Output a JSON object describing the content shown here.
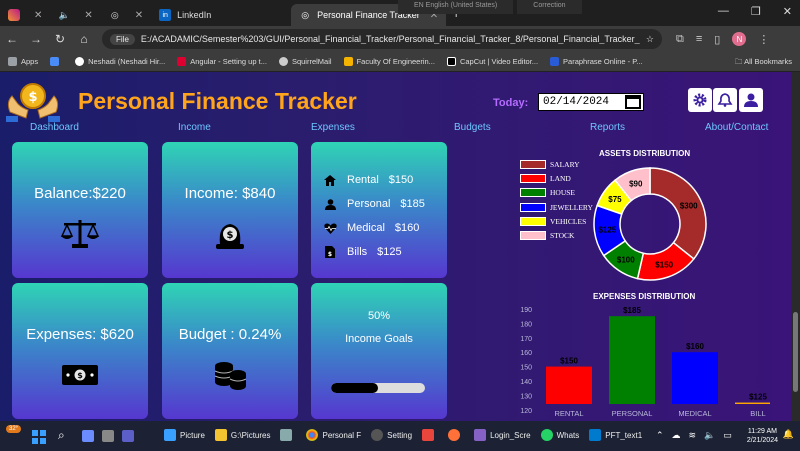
{
  "browser": {
    "tabs": [
      {
        "label": "",
        "icon": "instagram-icon"
      },
      {
        "label": "",
        "icon": "audio-icon"
      },
      {
        "label": "",
        "icon": "globe-icon"
      },
      {
        "label": "LinkedIn",
        "icon": "linkedin-icon"
      },
      {
        "label": "Personal Finance Tracker",
        "icon": "globe-icon",
        "active": true
      }
    ],
    "overlay_left": "EN English (United States)",
    "overlay_right": "Correction",
    "file_chip": "File",
    "url": "E:/ACADAMIC/Semester%203/GUI/Personal_Financial_Tracker/Personal_Financial_Tracker_8/Personal_Financial_Tracker_6/PFT_text1....",
    "profile_initial": "N",
    "bookmarks": [
      {
        "label": "Apps",
        "color": "#9aa0a6"
      },
      {
        "label": "",
        "color": "#4a8cf7"
      },
      {
        "label": "Neshadi (Neshadi Hir...",
        "color": "#ffffff"
      },
      {
        "label": "Angular - Setting up t...",
        "color": "#dd0031"
      },
      {
        "label": "SquirrelMail",
        "color": "#cccccc"
      },
      {
        "label": "Faculty Of Engineerin...",
        "color": "#f4b400"
      },
      {
        "label": "CapCut | Video Editor...",
        "color": "#000000"
      },
      {
        "label": "Paraphrase Online - P...",
        "color": "#2a5bd7"
      }
    ],
    "all_bookmarks": "All Bookmarks"
  },
  "app": {
    "title": "Personal Finance Tracker",
    "today_label": "Today:",
    "date_value": "02/14/2024",
    "nav": [
      "Dashboard",
      "Income",
      "Expenses",
      "Budgets",
      "Reports",
      "About/Contact"
    ],
    "cards": {
      "balance": "Balance:$220",
      "income": "Income: $840",
      "expenses": "Expenses: $620",
      "budget": "Budget : 0.24%",
      "goals_percent": "50%",
      "goals_label": "Income Goals",
      "goals_progress": 0.5
    },
    "expense_list": [
      {
        "label": "Rental",
        "amount": "$150",
        "icon": "home-icon"
      },
      {
        "label": "Personal",
        "amount": "$185",
        "icon": "user-icon"
      },
      {
        "label": "Medical",
        "amount": "$160",
        "icon": "heartbeat-icon"
      },
      {
        "label": "Bills",
        "amount": "$125",
        "icon": "bill-icon"
      }
    ]
  },
  "chart_data": [
    {
      "type": "pie",
      "title": "ASSETS DISTRIBUTION",
      "categories": [
        "SALARY",
        "LAND",
        "HOUSE",
        "JEWELLERY",
        "VEHICLES",
        "STOCK"
      ],
      "values": [
        300,
        150,
        100,
        125,
        75,
        90
      ],
      "labels": [
        "$300",
        "$150",
        "$100",
        "$125",
        "$75",
        "$90"
      ],
      "colors": [
        "#a52a2a",
        "#ff0000",
        "#008000",
        "#0000ff",
        "#ffff00",
        "#ffc0cb"
      ],
      "legend": "left"
    },
    {
      "type": "bar",
      "title": "EXPENSES DISTRIBUTION",
      "categories": [
        "RENTAL",
        "PERSONAL",
        "MEDICAL",
        "BILL"
      ],
      "values": [
        150,
        185,
        160,
        125
      ],
      "labels": [
        "$150",
        "$185",
        "$160",
        "$125"
      ],
      "colors": [
        "#ff0000",
        "#008000",
        "#0000ff",
        "#ffa500"
      ],
      "yticks": [
        120,
        130,
        140,
        150,
        160,
        170,
        180,
        190
      ],
      "ylim": [
        124,
        190
      ]
    }
  ],
  "taskbar": {
    "weather": "32°",
    "items": [
      "Picture",
      "G:\\Pictures",
      "Personal F",
      "Setting",
      "Login_Scre",
      "Whats",
      "PFT_text1"
    ],
    "time": "11:29 AM",
    "date": "2/21/2024"
  }
}
